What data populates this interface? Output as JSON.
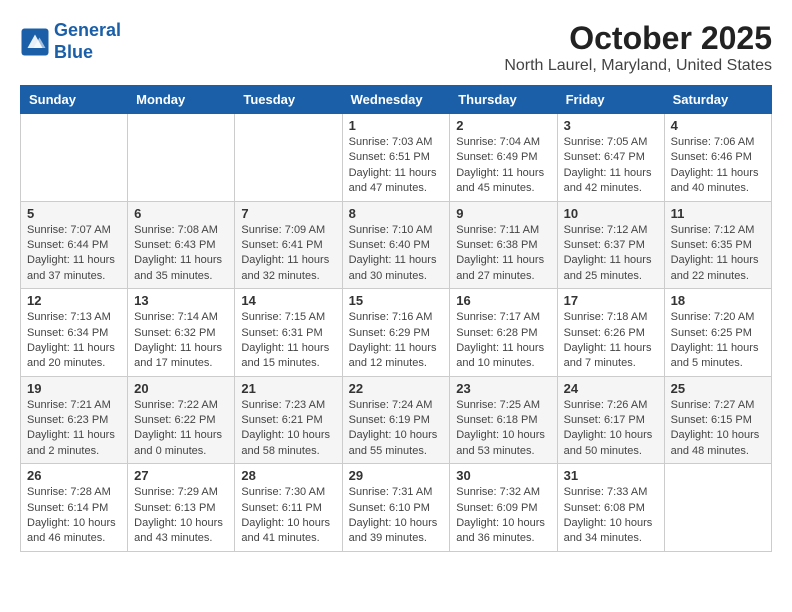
{
  "header": {
    "logo_line1": "General",
    "logo_line2": "Blue",
    "month_title": "October 2025",
    "location": "North Laurel, Maryland, United States"
  },
  "days_of_week": [
    "Sunday",
    "Monday",
    "Tuesday",
    "Wednesday",
    "Thursday",
    "Friday",
    "Saturday"
  ],
  "weeks": [
    [
      {
        "day": "",
        "info": ""
      },
      {
        "day": "",
        "info": ""
      },
      {
        "day": "",
        "info": ""
      },
      {
        "day": "1",
        "info": "Sunrise: 7:03 AM\nSunset: 6:51 PM\nDaylight: 11 hours and 47 minutes."
      },
      {
        "day": "2",
        "info": "Sunrise: 7:04 AM\nSunset: 6:49 PM\nDaylight: 11 hours and 45 minutes."
      },
      {
        "day": "3",
        "info": "Sunrise: 7:05 AM\nSunset: 6:47 PM\nDaylight: 11 hours and 42 minutes."
      },
      {
        "day": "4",
        "info": "Sunrise: 7:06 AM\nSunset: 6:46 PM\nDaylight: 11 hours and 40 minutes."
      }
    ],
    [
      {
        "day": "5",
        "info": "Sunrise: 7:07 AM\nSunset: 6:44 PM\nDaylight: 11 hours and 37 minutes."
      },
      {
        "day": "6",
        "info": "Sunrise: 7:08 AM\nSunset: 6:43 PM\nDaylight: 11 hours and 35 minutes."
      },
      {
        "day": "7",
        "info": "Sunrise: 7:09 AM\nSunset: 6:41 PM\nDaylight: 11 hours and 32 minutes."
      },
      {
        "day": "8",
        "info": "Sunrise: 7:10 AM\nSunset: 6:40 PM\nDaylight: 11 hours and 30 minutes."
      },
      {
        "day": "9",
        "info": "Sunrise: 7:11 AM\nSunset: 6:38 PM\nDaylight: 11 hours and 27 minutes."
      },
      {
        "day": "10",
        "info": "Sunrise: 7:12 AM\nSunset: 6:37 PM\nDaylight: 11 hours and 25 minutes."
      },
      {
        "day": "11",
        "info": "Sunrise: 7:12 AM\nSunset: 6:35 PM\nDaylight: 11 hours and 22 minutes."
      }
    ],
    [
      {
        "day": "12",
        "info": "Sunrise: 7:13 AM\nSunset: 6:34 PM\nDaylight: 11 hours and 20 minutes."
      },
      {
        "day": "13",
        "info": "Sunrise: 7:14 AM\nSunset: 6:32 PM\nDaylight: 11 hours and 17 minutes."
      },
      {
        "day": "14",
        "info": "Sunrise: 7:15 AM\nSunset: 6:31 PM\nDaylight: 11 hours and 15 minutes."
      },
      {
        "day": "15",
        "info": "Sunrise: 7:16 AM\nSunset: 6:29 PM\nDaylight: 11 hours and 12 minutes."
      },
      {
        "day": "16",
        "info": "Sunrise: 7:17 AM\nSunset: 6:28 PM\nDaylight: 11 hours and 10 minutes."
      },
      {
        "day": "17",
        "info": "Sunrise: 7:18 AM\nSunset: 6:26 PM\nDaylight: 11 hours and 7 minutes."
      },
      {
        "day": "18",
        "info": "Sunrise: 7:20 AM\nSunset: 6:25 PM\nDaylight: 11 hours and 5 minutes."
      }
    ],
    [
      {
        "day": "19",
        "info": "Sunrise: 7:21 AM\nSunset: 6:23 PM\nDaylight: 11 hours and 2 minutes."
      },
      {
        "day": "20",
        "info": "Sunrise: 7:22 AM\nSunset: 6:22 PM\nDaylight: 11 hours and 0 minutes."
      },
      {
        "day": "21",
        "info": "Sunrise: 7:23 AM\nSunset: 6:21 PM\nDaylight: 10 hours and 58 minutes."
      },
      {
        "day": "22",
        "info": "Sunrise: 7:24 AM\nSunset: 6:19 PM\nDaylight: 10 hours and 55 minutes."
      },
      {
        "day": "23",
        "info": "Sunrise: 7:25 AM\nSunset: 6:18 PM\nDaylight: 10 hours and 53 minutes."
      },
      {
        "day": "24",
        "info": "Sunrise: 7:26 AM\nSunset: 6:17 PM\nDaylight: 10 hours and 50 minutes."
      },
      {
        "day": "25",
        "info": "Sunrise: 7:27 AM\nSunset: 6:15 PM\nDaylight: 10 hours and 48 minutes."
      }
    ],
    [
      {
        "day": "26",
        "info": "Sunrise: 7:28 AM\nSunset: 6:14 PM\nDaylight: 10 hours and 46 minutes."
      },
      {
        "day": "27",
        "info": "Sunrise: 7:29 AM\nSunset: 6:13 PM\nDaylight: 10 hours and 43 minutes."
      },
      {
        "day": "28",
        "info": "Sunrise: 7:30 AM\nSunset: 6:11 PM\nDaylight: 10 hours and 41 minutes."
      },
      {
        "day": "29",
        "info": "Sunrise: 7:31 AM\nSunset: 6:10 PM\nDaylight: 10 hours and 39 minutes."
      },
      {
        "day": "30",
        "info": "Sunrise: 7:32 AM\nSunset: 6:09 PM\nDaylight: 10 hours and 36 minutes."
      },
      {
        "day": "31",
        "info": "Sunrise: 7:33 AM\nSunset: 6:08 PM\nDaylight: 10 hours and 34 minutes."
      },
      {
        "day": "",
        "info": ""
      }
    ]
  ]
}
